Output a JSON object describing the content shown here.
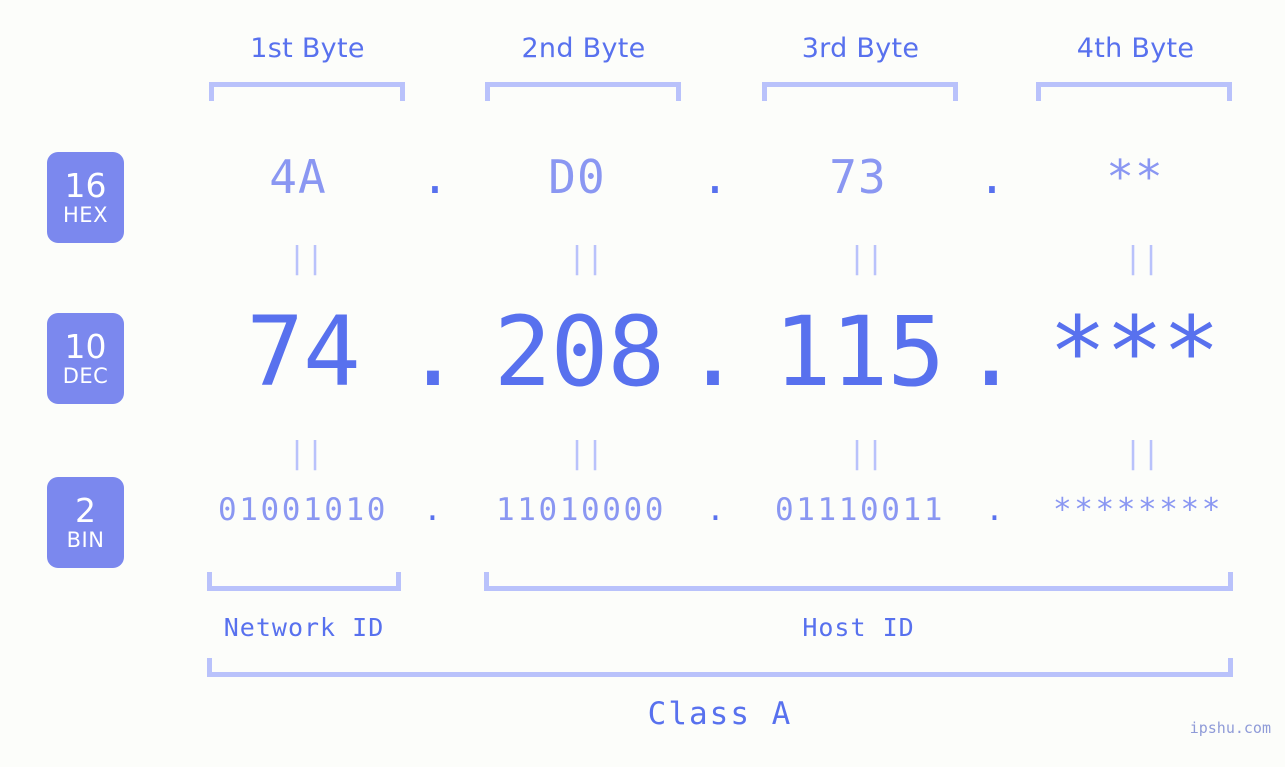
{
  "meta": {
    "watermark": "ipshu.com",
    "background_color": "#fcfdfa",
    "accent_color": "#5871ee",
    "accent_light_color": "#8a97f2",
    "bracket_color": "#b9c2fb",
    "badge_color": "#7b88ee"
  },
  "headers": [
    {
      "label": "1st Byte"
    },
    {
      "label": "2nd Byte"
    },
    {
      "label": "3rd Byte"
    },
    {
      "label": "4th Byte"
    }
  ],
  "bases": [
    {
      "number": "16",
      "name": "HEX"
    },
    {
      "number": "10",
      "name": "DEC"
    },
    {
      "number": "2",
      "name": "BIN"
    }
  ],
  "rows": {
    "hex": {
      "values": [
        "4A",
        "D0",
        "73",
        "**"
      ],
      "separators": [
        ".",
        ".",
        "."
      ]
    },
    "dec": {
      "values": [
        "74",
        "208",
        "115",
        "***"
      ],
      "separators": [
        ".",
        ".",
        "."
      ]
    },
    "bin": {
      "values": [
        "01001010",
        "11010000",
        "01110011",
        "********"
      ],
      "separators": [
        ".",
        ".",
        "."
      ]
    }
  },
  "equals": {
    "glyph": "||"
  },
  "sections": [
    {
      "label": "Network ID"
    },
    {
      "label": "Host ID"
    }
  ],
  "class": {
    "label": "Class A"
  }
}
